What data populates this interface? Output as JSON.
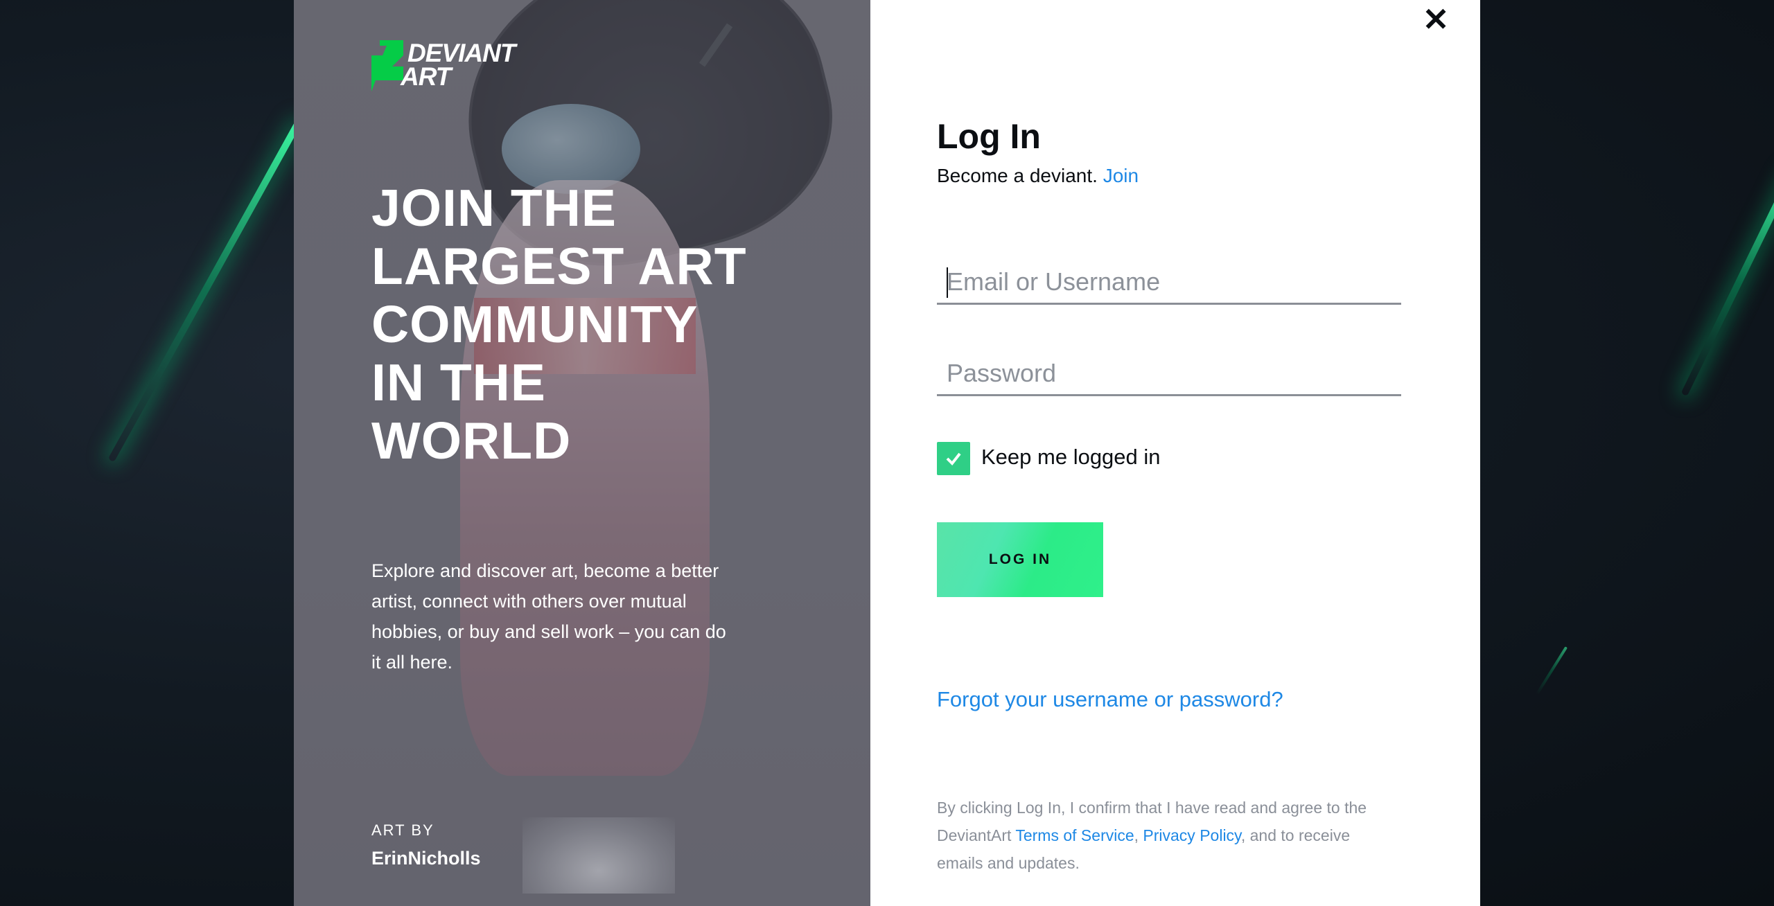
{
  "brand": {
    "logo_line1": "DEVIANT",
    "logo_line2": "ART",
    "accent_color": "#05cc47"
  },
  "promo": {
    "headline": "JOIN THE LARGEST ART COMMUNITY IN THE WORLD",
    "blurb": "Explore and discover art, become a better artist, connect with others over mutual hobbies, or buy and sell work – you can do it all here.",
    "art_by_label": "ART BY",
    "artist_name": "ErinNicholls"
  },
  "form": {
    "title": "Log In",
    "subtitle_text": "Become a deviant.",
    "join_link": "Join",
    "email_placeholder": "Email or Username",
    "email_value": "",
    "password_placeholder": "Password",
    "password_value": "",
    "keep_logged_in_label": "Keep me logged in",
    "keep_logged_in_checked": true,
    "login_button": "LOG IN",
    "forgot_link": "Forgot your username or password?",
    "legal_prefix": "By clicking Log In, I confirm that I have read and agree to the DeviantArt",
    "terms_link": "Terms of Service",
    "legal_comma": ",",
    "privacy_link": "Privacy Policy",
    "legal_suffix": ", and to receive emails and updates.",
    "close_icon": "close-icon",
    "link_color": "#1e88e5",
    "checkbox_color": "#2fcf86"
  }
}
